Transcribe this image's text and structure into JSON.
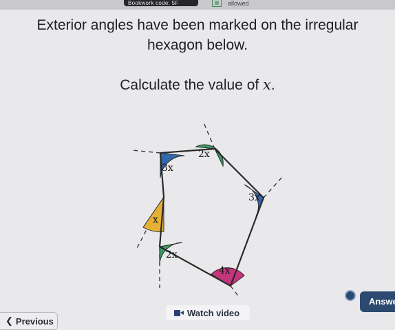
{
  "header": {
    "bookwork_label": "Bookwork code: 5F",
    "calculator_icon": "calculator-icon",
    "calculator_status": "allowed"
  },
  "question": {
    "line1": "Exterior angles have been marked on the irregular",
    "line2": "hexagon below.",
    "instruction_prefix": "Calculate the value of ",
    "instruction_var": "x",
    "instruction_suffix": "."
  },
  "diagram": {
    "angles": [
      {
        "label": "2x",
        "color": "#3e9a61"
      },
      {
        "label": "3x",
        "color": "#3269ad"
      },
      {
        "label": "3x",
        "color": "#3269ad"
      },
      {
        "label": "x",
        "color": "#e5b034"
      },
      {
        "label": "2x",
        "color": "#3e9a61"
      },
      {
        "label": "4x",
        "color": "#c5357c"
      }
    ]
  },
  "footer": {
    "previous_label": "Previous",
    "watch_label": "Watch video",
    "answer_label": "Answe"
  },
  "colors": {
    "green": "#3e9a61",
    "blue": "#3269ad",
    "yellow": "#e5b034",
    "pink": "#c5357c",
    "answer_button": "#2c4a6f"
  }
}
